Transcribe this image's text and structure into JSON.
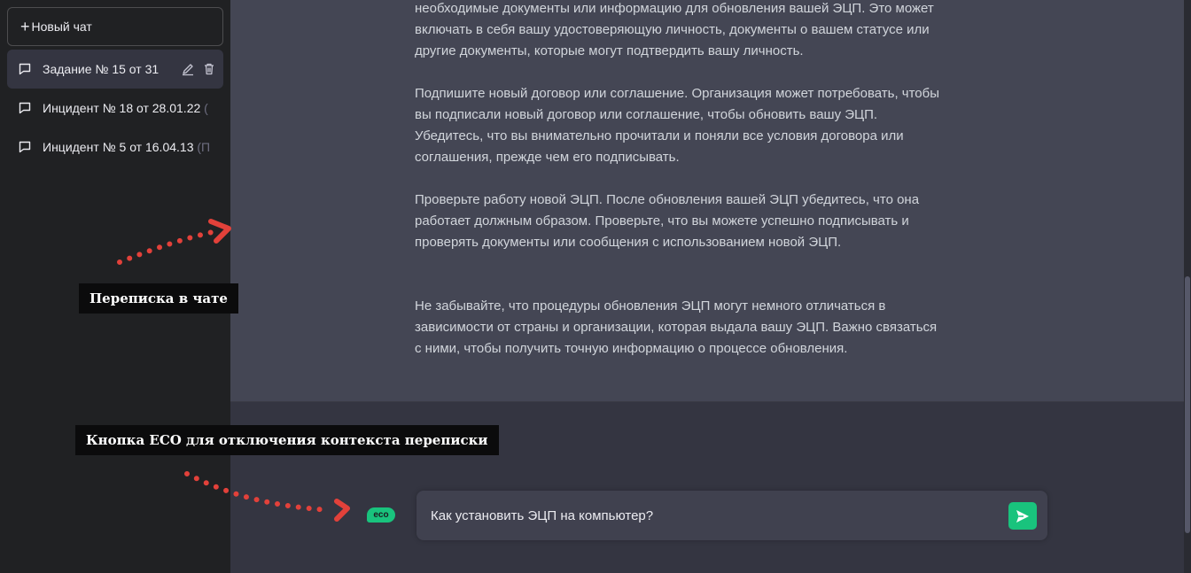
{
  "sidebar": {
    "new_chat_label": "Новый чат",
    "items": [
      {
        "label": "Задание № 15 от 31",
        "tail": ""
      },
      {
        "label": "Инцидент № 18 от 28.01.22 ",
        "tail": "("
      },
      {
        "label": "Инцидент № 5 от 16.04.13 ",
        "tail": "(П"
      }
    ]
  },
  "messages": {
    "p1": "необходимые документы или информацию для обновления вашей ЭЦП. Это может включать в себя вашу удостоверяющую личность, документы о вашем статусе или другие документы, которые могут подтвердить вашу личность.",
    "p2": "Подпишите новый договор или соглашение. Организация может потребовать, чтобы вы подписали новый договор или соглашение, чтобы обновить вашу ЭЦП. Убедитесь, что вы внимательно прочитали и поняли все условия договора или соглашения, прежде чем его подписывать.",
    "p3": "Проверьте работу новой ЭЦП. После обновления вашей ЭЦП убедитесь, что она работает должным образом. Проверьте, что вы можете успешно подписывать и проверять документы или сообщения с использованием новой ЭЦП.",
    "p4": "Не забывайте, что процедуры обновления ЭЦП могут немного отличаться в зависимости от страны и организации, которая выдала вашу ЭЦП. Важно связаться с ними, чтобы получить точную информацию о процессе обновления."
  },
  "annotations": {
    "chat_label": "Переписка в чате",
    "eco_label": "Кнопка ECO для отключения контекста переписки"
  },
  "eco_button": {
    "label": "eco"
  },
  "composer": {
    "value": "Как установить ЭЦП на компьютер?"
  },
  "colors": {
    "accent": "#19c37d",
    "sidebar": "#202123",
    "main": "#343541",
    "message": "#444654",
    "annotation_arrow": "#e2413a"
  },
  "icons": [
    "plus-icon",
    "message-icon",
    "edit-icon",
    "trash-icon",
    "send-icon"
  ]
}
